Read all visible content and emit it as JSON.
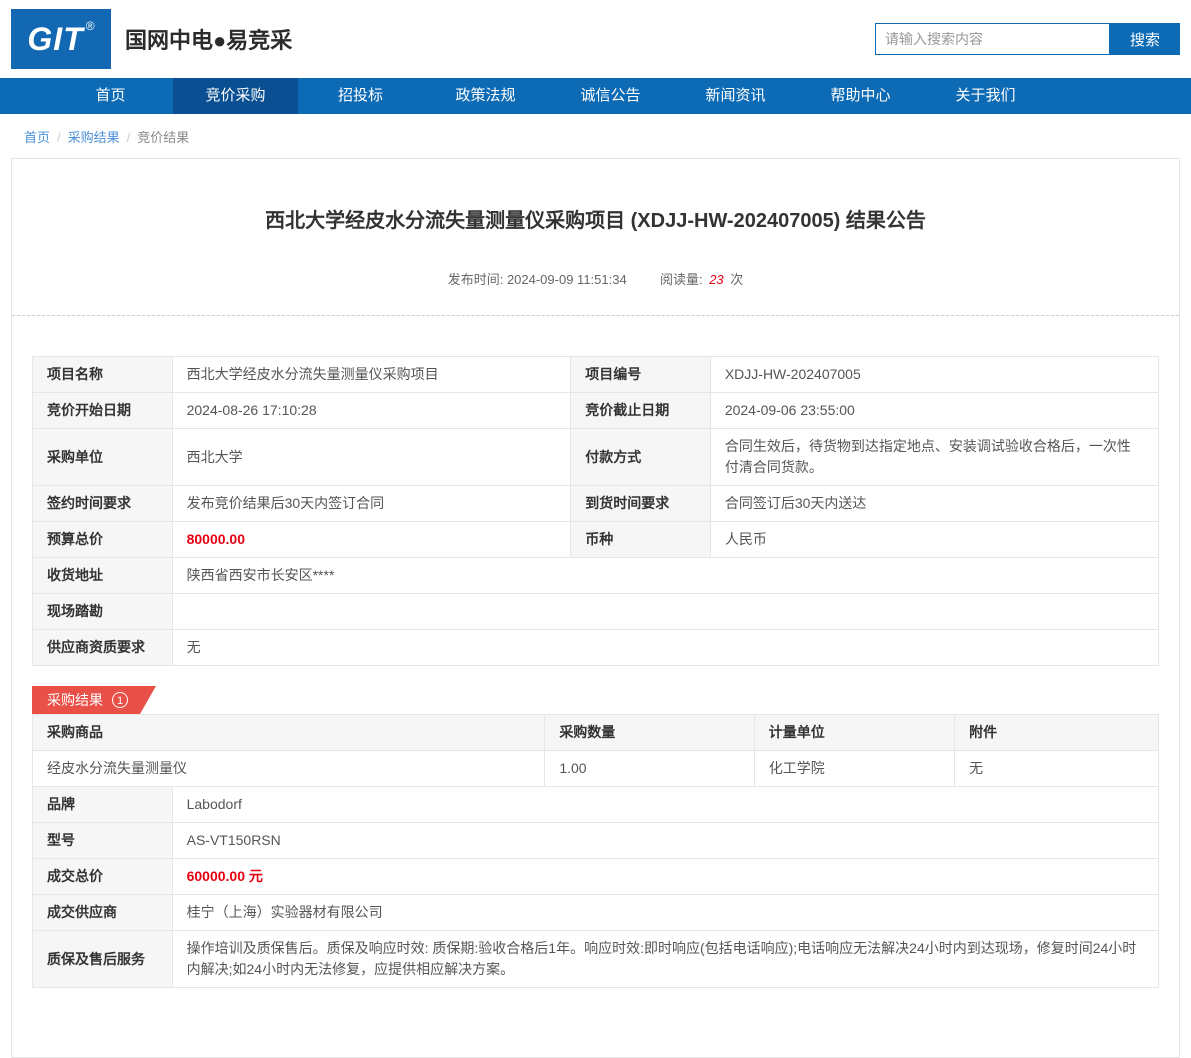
{
  "colors": {
    "nav_blue": "#0d6ab5",
    "nav_active": "#0a4f92",
    "logo_blue": "#1268b3",
    "badge_red": "#e85048",
    "price_red": "#e60012",
    "link_blue": "#4a90d9"
  },
  "header": {
    "logo_text": "GIT",
    "logo_reg": "®",
    "site_name": "国网中电●易竞采",
    "search": {
      "placeholder": "请输入搜索内容",
      "button_label": "搜索"
    }
  },
  "nav": {
    "items": [
      {
        "label": "首页",
        "active": false
      },
      {
        "label": "竞价采购",
        "active": true
      },
      {
        "label": "招投标",
        "active": false
      },
      {
        "label": "政策法规",
        "active": false
      },
      {
        "label": "诚信公告",
        "active": false
      },
      {
        "label": "新闻资讯",
        "active": false
      },
      {
        "label": "帮助中心",
        "active": false
      },
      {
        "label": "关于我们",
        "active": false
      }
    ]
  },
  "breadcrumb": {
    "separator": "/",
    "items": [
      {
        "label": "首页",
        "link": true
      },
      {
        "label": "采购结果",
        "link": true
      },
      {
        "label": "竞价结果",
        "link": false
      }
    ]
  },
  "article": {
    "title": "西北大学经皮水分流失量测量仪采购项目 (XDJJ-HW-202407005) 结果公告",
    "publish_label": "发布时间:",
    "publish_time": "2024-09-09 11:51:34",
    "views_label": "阅读量:",
    "views_count": "23",
    "views_unit": "次"
  },
  "info_table": {
    "rows": [
      {
        "cells": [
          {
            "text": "项目名称",
            "header": true
          },
          {
            "text": "西北大学经皮水分流失量测量仪采购项目"
          },
          {
            "text": "项目编号",
            "header": true
          },
          {
            "text": "XDJJ-HW-202407005"
          }
        ]
      },
      {
        "cells": [
          {
            "text": "竞价开始日期",
            "header": true
          },
          {
            "text": "2024-08-26 17:10:28"
          },
          {
            "text": "竞价截止日期",
            "header": true
          },
          {
            "text": "2024-09-06 23:55:00"
          }
        ]
      },
      {
        "cells": [
          {
            "text": "采购单位",
            "header": true
          },
          {
            "text": "西北大学"
          },
          {
            "text": "付款方式",
            "header": true
          },
          {
            "text": "合同生效后，待货物到达指定地点、安装调试验收合格后，一次性付清合同货款。"
          }
        ]
      },
      {
        "cells": [
          {
            "text": "签约时间要求",
            "header": true
          },
          {
            "text": "发布竞价结果后30天内签订合同"
          },
          {
            "text": "到货时间要求",
            "header": true
          },
          {
            "text": "合同签订后30天内送达"
          }
        ]
      },
      {
        "cells": [
          {
            "text": "预算总价",
            "header": true
          },
          {
            "text": "80000.00",
            "red": true
          },
          {
            "text": "币种",
            "header": true
          },
          {
            "text": "人民币"
          }
        ]
      },
      {
        "cells": [
          {
            "text": "收货地址",
            "header": true
          },
          {
            "text": "陕西省西安市长安区****",
            "span": 3
          }
        ]
      },
      {
        "cells": [
          {
            "text": "现场踏勘",
            "header": true
          },
          {
            "text": "",
            "span": 3
          }
        ]
      },
      {
        "cells": [
          {
            "text": "供应商资质要求",
            "header": true
          },
          {
            "text": "无",
            "span": 3
          }
        ]
      }
    ]
  },
  "result_section": {
    "badge_label": "采购结果",
    "badge_count": "1"
  },
  "result_table": {
    "headers": [
      "采购商品",
      "采购数量",
      "计量单位",
      "附件"
    ],
    "product_row": [
      "经皮水分流失量测量仪",
      "1.00",
      "化工学院",
      "无"
    ],
    "detail_rows": [
      {
        "label": "品牌",
        "value": "Labodorf"
      },
      {
        "label": "型号",
        "value": "AS-VT150RSN"
      },
      {
        "label": "成交总价",
        "value": "60000.00 元",
        "red": true
      },
      {
        "label": "成交供应商",
        "value": "桂宁（上海）实验器材有限公司"
      },
      {
        "label": "质保及售后服务",
        "value": "操作培训及质保售后。质保及响应时效: 质保期:验收合格后1年。响应时效:即时响应(包括电话响应);电话响应无法解决24小时内到达现场，修复时间24小时内解决;如24小时内无法修复，应提供相应解决方案。"
      }
    ]
  }
}
